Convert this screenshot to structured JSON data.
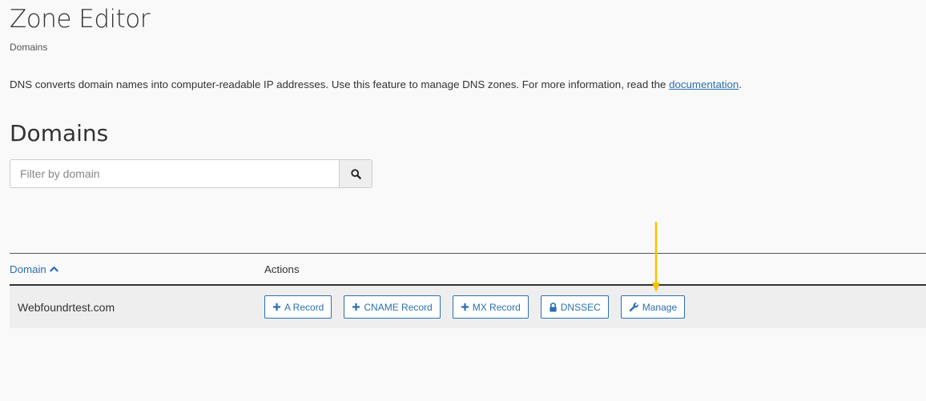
{
  "header": {
    "title": "Zone Editor",
    "breadcrumb": "Domains"
  },
  "description": {
    "text": "DNS converts domain names into computer-readable IP addresses. Use this feature to manage DNS zones. For more information, read the ",
    "link_label": "documentation",
    "suffix": "."
  },
  "section": {
    "title": "Domains"
  },
  "search": {
    "placeholder": "Filter by domain",
    "value": "",
    "icon": "search-icon"
  },
  "table": {
    "columns": [
      "Domain",
      "Actions"
    ],
    "sort_icon": "chevron-up-icon",
    "rows": [
      {
        "domain": "Webfoundrtest.com",
        "actions": [
          {
            "label": "A Record",
            "icon": "plus-icon"
          },
          {
            "label": "CNAME Record",
            "icon": "plus-icon"
          },
          {
            "label": "MX Record",
            "icon": "plus-icon"
          },
          {
            "label": "DNSSEC",
            "icon": "lock-icon"
          },
          {
            "label": "Manage",
            "icon": "wrench-icon"
          }
        ]
      }
    ]
  },
  "colors": {
    "accent": "#2d6fb2",
    "callout_arrow": "#f5c400",
    "row_background": "#eeeeee"
  }
}
